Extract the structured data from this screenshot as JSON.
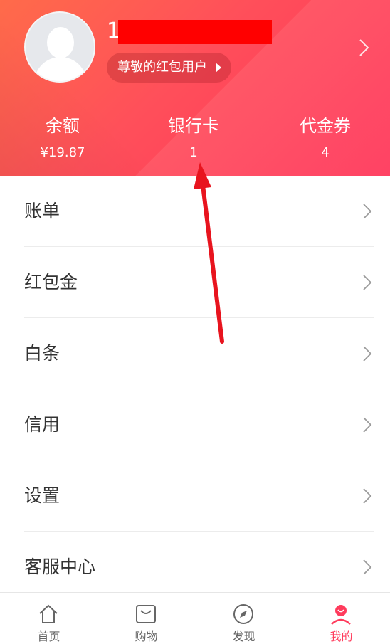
{
  "profile": {
    "username": "1",
    "level_label": "尊敬的红包用户"
  },
  "stats": [
    {
      "label": "余额",
      "value": "¥19.87"
    },
    {
      "label": "银行卡",
      "value": "1"
    },
    {
      "label": "代金券",
      "value": "4"
    }
  ],
  "menu": [
    {
      "label": "账单"
    },
    {
      "label": "红包金"
    },
    {
      "label": "白条"
    },
    {
      "label": "信用"
    },
    {
      "label": "设置"
    },
    {
      "label": "客服中心"
    }
  ],
  "tabbar": [
    {
      "label": "首页",
      "icon": "home-icon"
    },
    {
      "label": "购物",
      "icon": "shopping-bag-icon"
    },
    {
      "label": "发现",
      "icon": "compass-icon"
    },
    {
      "label": "我的",
      "icon": "user-icon",
      "active": true
    }
  ],
  "colors": {
    "accent": "#ff3b5c",
    "header_start": "#ff6b4a",
    "header_end": "#ff3257",
    "annotation_arrow": "#e8141e"
  }
}
